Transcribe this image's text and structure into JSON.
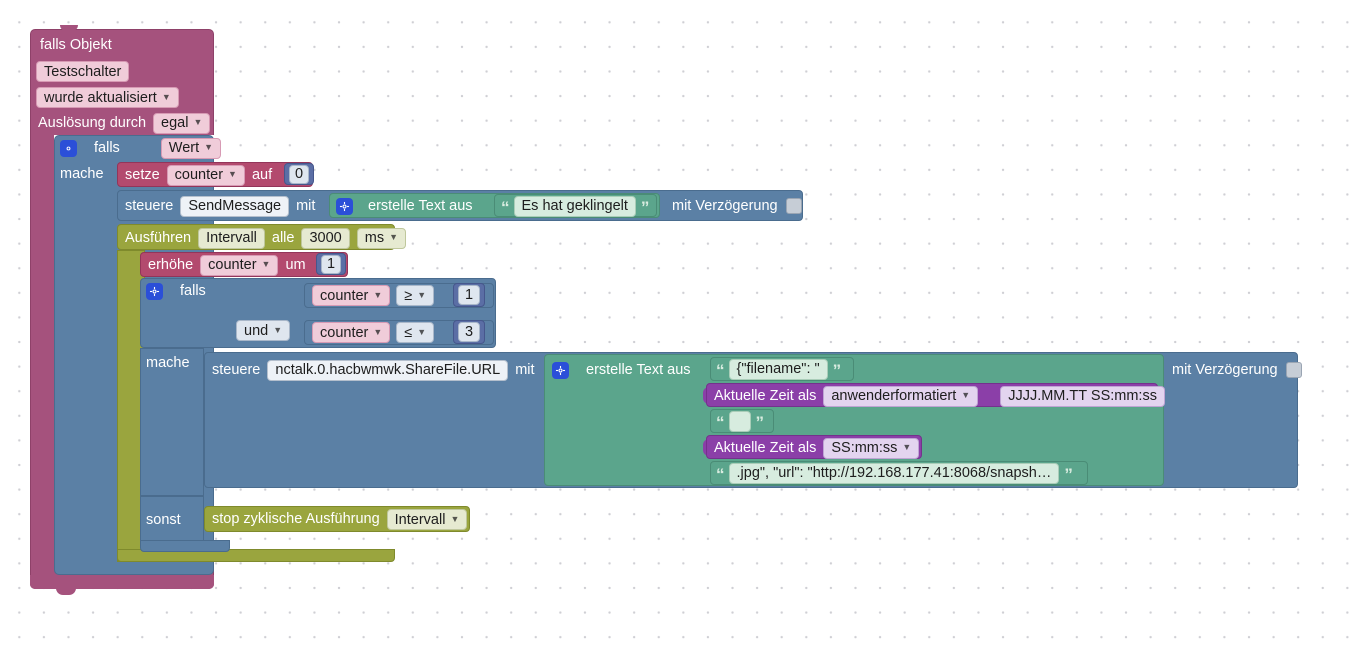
{
  "editor": {
    "name": "blockly-workspace",
    "language": "de"
  },
  "colors": {
    "trigger": "#a5527d",
    "control": "#5b80a5",
    "variable": "#b34a6e",
    "timer": "#9aa53e",
    "text": "#5ba58c",
    "datetime": "#8b3fa8",
    "gear": "#2b4fd8",
    "canvas_bg": "#ffffff",
    "grid_dot": "#cfcfd4"
  },
  "trigger_block": {
    "title": "falls Objekt",
    "object_id": "Testschalter",
    "condition": "wurde aktualisiert",
    "trigger_by_label": "Auslösung durch",
    "trigger_by_value": "egal"
  },
  "if_outer": {
    "if_label": "falls",
    "value_dropdown": "Wert",
    "do_label": "mache"
  },
  "set_variable": {
    "set_label": "setze",
    "variable": "counter",
    "to_label": "auf",
    "value": "0"
  },
  "sendto_block": {
    "control_label": "steuere",
    "instance": "SendMessage",
    "with_label": "mit",
    "delay_label": "mit Verzögerung",
    "delay_checked": false,
    "create_text_label": "erstelle Text aus",
    "message_text": "Es hat geklingelt"
  },
  "interval_block": {
    "execute_label": "Ausführen",
    "name": "Intervall",
    "every_label": "alle",
    "value": "3000",
    "unit": "ms"
  },
  "increment_block": {
    "increase_label": "erhöhe",
    "variable": "counter",
    "by_label": "um",
    "value": "1"
  },
  "if_inner": {
    "if_label": "falls",
    "and_label": "und",
    "do_label": "mache",
    "else_label": "sonst",
    "conditions": [
      {
        "variable": "counter",
        "operator": "≥",
        "value": "1"
      },
      {
        "variable": "counter",
        "operator": "≤",
        "value": "3"
      }
    ]
  },
  "setstate_block": {
    "control_label": "steuere",
    "object_id": "nctalk.0.hacbwmwk.ShareFile.URL",
    "with_label": "mit",
    "delay_label": "mit Verzögerung",
    "delay_checked": false,
    "create_text_label": "erstelle Text aus",
    "parts": [
      {
        "kind": "text",
        "value": "{\"filename\": \""
      },
      {
        "kind": "datetime",
        "label": "Aktuelle Zeit als",
        "format_mode": "anwenderformatiert",
        "format_value": "JJJJ.MM.TT SS:mm:ss"
      },
      {
        "kind": "text",
        "value": ""
      },
      {
        "kind": "datetime",
        "label": "Aktuelle Zeit als",
        "format_mode": "SS:mm:ss",
        "format_value": ""
      },
      {
        "kind": "text",
        "value": ".jpg\", \"url\": \"http://192.168.177.41:8068/snapsh…"
      }
    ]
  },
  "stop_block": {
    "label": "stop zyklische Ausführung",
    "name": "Intervall"
  }
}
